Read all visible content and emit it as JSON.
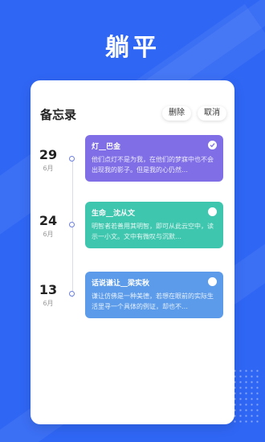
{
  "app": {
    "title": "躺平"
  },
  "panel": {
    "header": "备忘录",
    "delete_label": "删除",
    "cancel_label": "取消"
  },
  "notes": [
    {
      "day": "29",
      "month": "6月",
      "title": "灯__巴金",
      "excerpt": "他们点灯不是为我，在他们的梦寐中也不会出现我的影子。但是我的心仍然…",
      "color": "#7f6ee6",
      "checked": true
    },
    {
      "day": "24",
      "month": "6月",
      "title": "生命__沈从文",
      "excerpt": "明智者若善用其明智，即可从此云空中，读示一小文。文中有微叹与沉默…",
      "color": "#3fc6ae",
      "checked": false
    },
    {
      "day": "13",
      "month": "6月",
      "title": "话说谦让__梁实秋",
      "excerpt": "谦让仿佛是一种美德，若想在眼前的实际生活里寻一个具体的例证，却也不…",
      "color": "#5b9bea",
      "checked": false
    }
  ]
}
